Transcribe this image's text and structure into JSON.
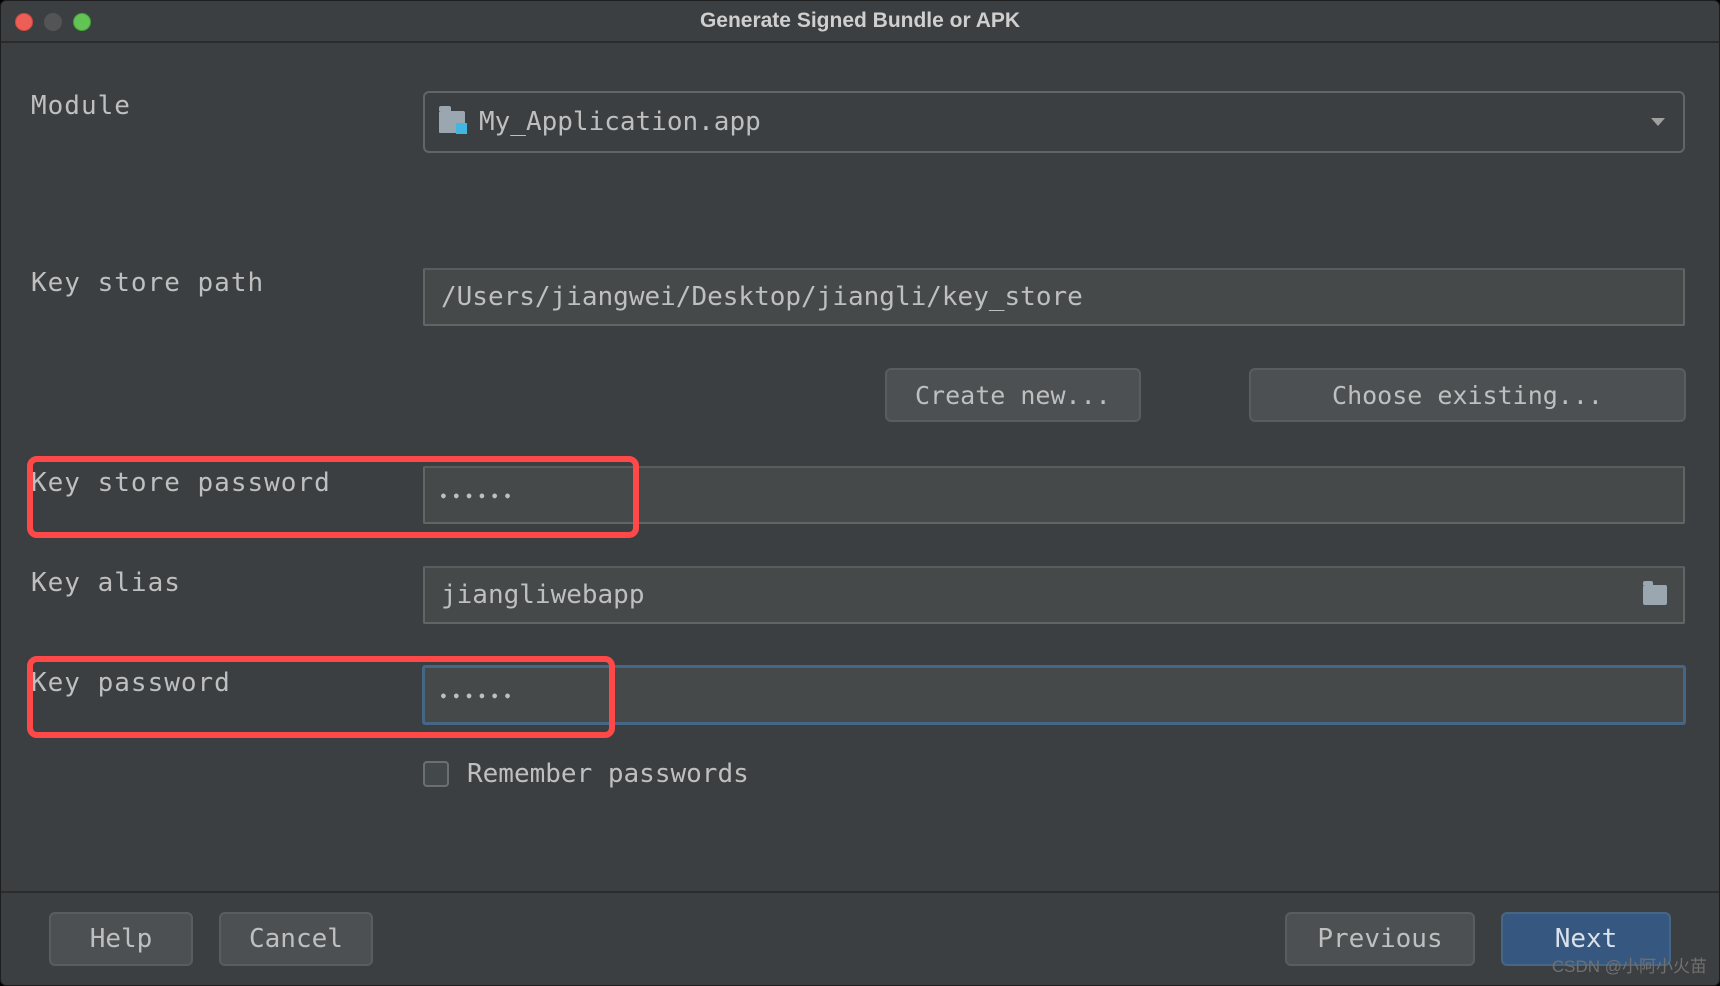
{
  "window": {
    "title": "Generate Signed Bundle or APK"
  },
  "module": {
    "label": "Module",
    "value": "My_Application.app"
  },
  "keystore_path": {
    "label": "Key store path",
    "value": "/Users/jiangwei/Desktop/jiangli/key_store",
    "create_btn": "Create new...",
    "choose_btn": "Choose existing..."
  },
  "keystore_password": {
    "label": "Key store password",
    "value": "●●●●●●"
  },
  "key_alias": {
    "label": "Key alias",
    "value": "jiangliwebapp"
  },
  "key_password": {
    "label": "Key password",
    "value": "●●●●●●"
  },
  "remember": {
    "label": "Remember passwords",
    "checked": false
  },
  "buttons": {
    "help": "Help",
    "cancel": "Cancel",
    "previous": "Previous",
    "next": "Next"
  },
  "watermark": "CSDN @小阿小火苗"
}
